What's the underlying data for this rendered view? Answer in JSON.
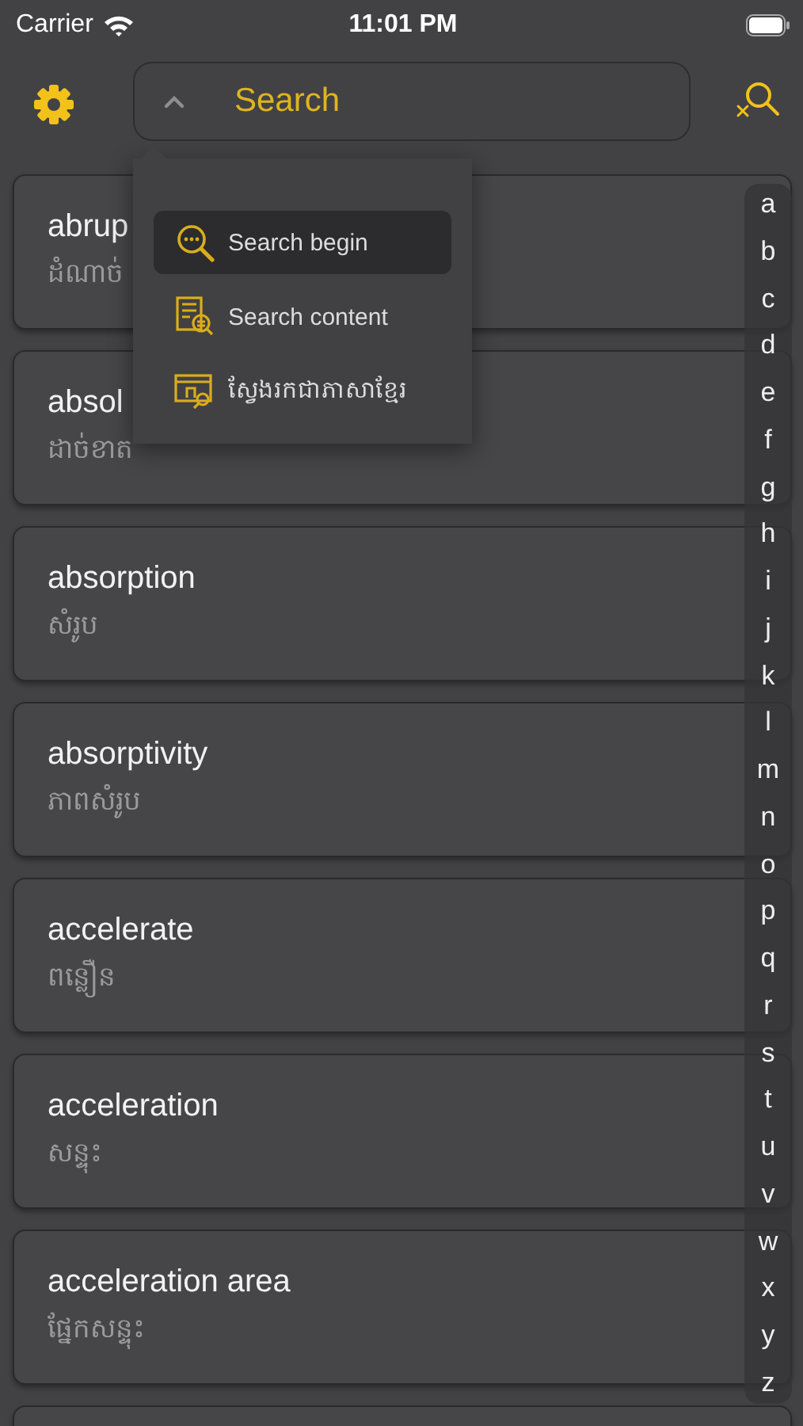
{
  "status_bar": {
    "carrier": "Carrier",
    "time": "11:01 PM"
  },
  "search": {
    "placeholder": "Search"
  },
  "search_menu": [
    {
      "kind": "begin",
      "label": "Search begin",
      "selected": true
    },
    {
      "kind": "content",
      "label": "Search content",
      "selected": false
    },
    {
      "kind": "khmer",
      "label": "ស្វែងរកជាភាសាខ្មែរ",
      "selected": false
    }
  ],
  "entries": [
    {
      "word": "abrup",
      "translation": "ដំណាច់"
    },
    {
      "word": "absol",
      "translation": "ដាច់ខាត"
    },
    {
      "word": "absorption",
      "translation": "សំរូប"
    },
    {
      "word": "absorptivity",
      "translation": "ភាពសំរូប"
    },
    {
      "word": "accelerate",
      "translation": "ពន្លឿន"
    },
    {
      "word": "acceleration",
      "translation": "សន្ទុះ"
    },
    {
      "word": "acceleration area",
      "translation": "ផ្នែកសន្ទុះ"
    }
  ],
  "index": [
    "a",
    "b",
    "c",
    "d",
    "e",
    "f",
    "g",
    "h",
    "i",
    "j",
    "k",
    "l",
    "m",
    "n",
    "o",
    "p",
    "q",
    "r",
    "s",
    "t",
    "u",
    "v",
    "w",
    "x",
    "y",
    "z"
  ]
}
